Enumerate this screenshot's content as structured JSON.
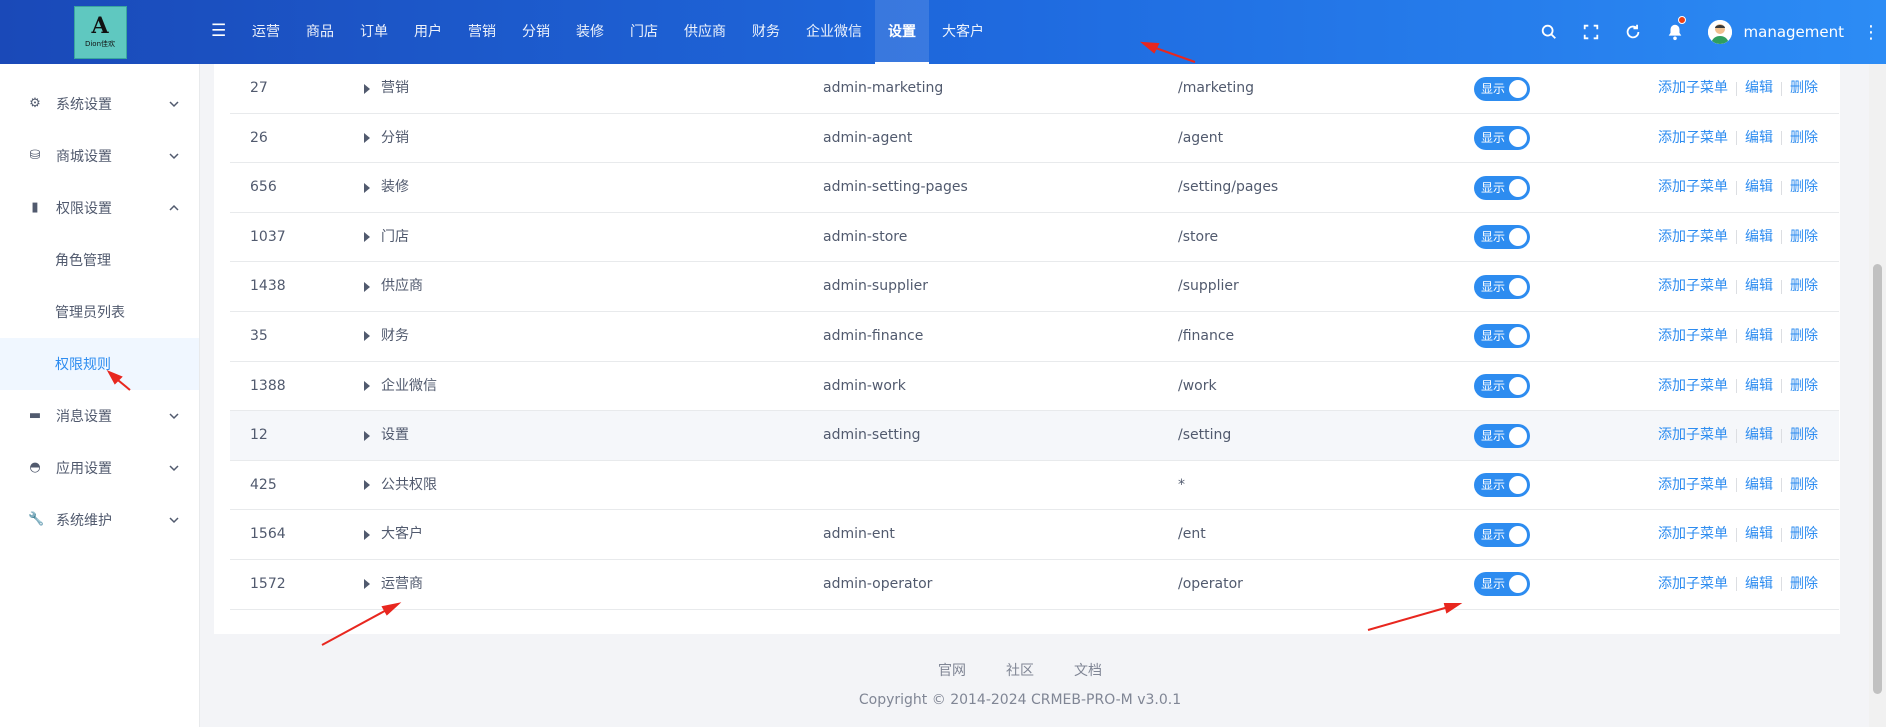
{
  "header": {
    "logo_text": "Dion佳欢",
    "nav": [
      "运营",
      "商品",
      "订单",
      "用户",
      "营销",
      "分销",
      "装修",
      "门店",
      "供应商",
      "财务",
      "企业微信",
      "设置",
      "大客户"
    ],
    "active_nav": "设置",
    "username": "management",
    "icons": [
      "search-icon",
      "fullscreen-icon",
      "refresh-icon",
      "bell-icon",
      "more-icon"
    ]
  },
  "sidebar": {
    "items": [
      {
        "label": "系统设置",
        "icon": "settings-icon",
        "expanded": false
      },
      {
        "label": "商城设置",
        "icon": "shop-icon",
        "expanded": false
      },
      {
        "label": "权限设置",
        "icon": "bookmark-icon",
        "expanded": true
      },
      {
        "label": "消息设置",
        "icon": "message-icon",
        "expanded": false
      },
      {
        "label": "应用设置",
        "icon": "app-icon",
        "expanded": false
      },
      {
        "label": "系统维护",
        "icon": "wrench-icon",
        "expanded": false
      }
    ],
    "subitems": [
      "角色管理",
      "管理员列表",
      "权限规则"
    ],
    "active_subitem": "权限规则"
  },
  "table": {
    "switch_label": "显示",
    "actions": [
      "添加子菜单",
      "编辑",
      "删除"
    ],
    "rows": [
      {
        "id": "27",
        "name": "营销",
        "code": "admin-marketing",
        "path": "/marketing"
      },
      {
        "id": "26",
        "name": "分销",
        "code": "admin-agent",
        "path": "/agent"
      },
      {
        "id": "656",
        "name": "装修",
        "code": "admin-setting-pages",
        "path": "/setting/pages"
      },
      {
        "id": "1037",
        "name": "门店",
        "code": "admin-store",
        "path": "/store"
      },
      {
        "id": "1438",
        "name": "供应商",
        "code": "admin-supplier",
        "path": "/supplier"
      },
      {
        "id": "35",
        "name": "财务",
        "code": "admin-finance",
        "path": "/finance"
      },
      {
        "id": "1388",
        "name": "企业微信",
        "code": "admin-work",
        "path": "/work"
      },
      {
        "id": "12",
        "name": "设置",
        "code": "admin-setting",
        "path": "/setting"
      },
      {
        "id": "425",
        "name": "公共权限",
        "code": "",
        "path": "*"
      },
      {
        "id": "1564",
        "name": "大客户",
        "code": "admin-ent",
        "path": "/ent"
      },
      {
        "id": "1572",
        "name": "运营商",
        "code": "admin-operator",
        "path": "/operator"
      }
    ]
  },
  "footer": {
    "links": [
      "官网",
      "社区",
      "文档"
    ],
    "copyright": "Copyright © 2014-2024 CRMEB-PRO-M v3.0.1"
  },
  "colors": {
    "primary": "#2d8cf0",
    "header_start": "#1a49b8",
    "header_end": "#2c8cf5",
    "annotation": "#e8271f"
  }
}
